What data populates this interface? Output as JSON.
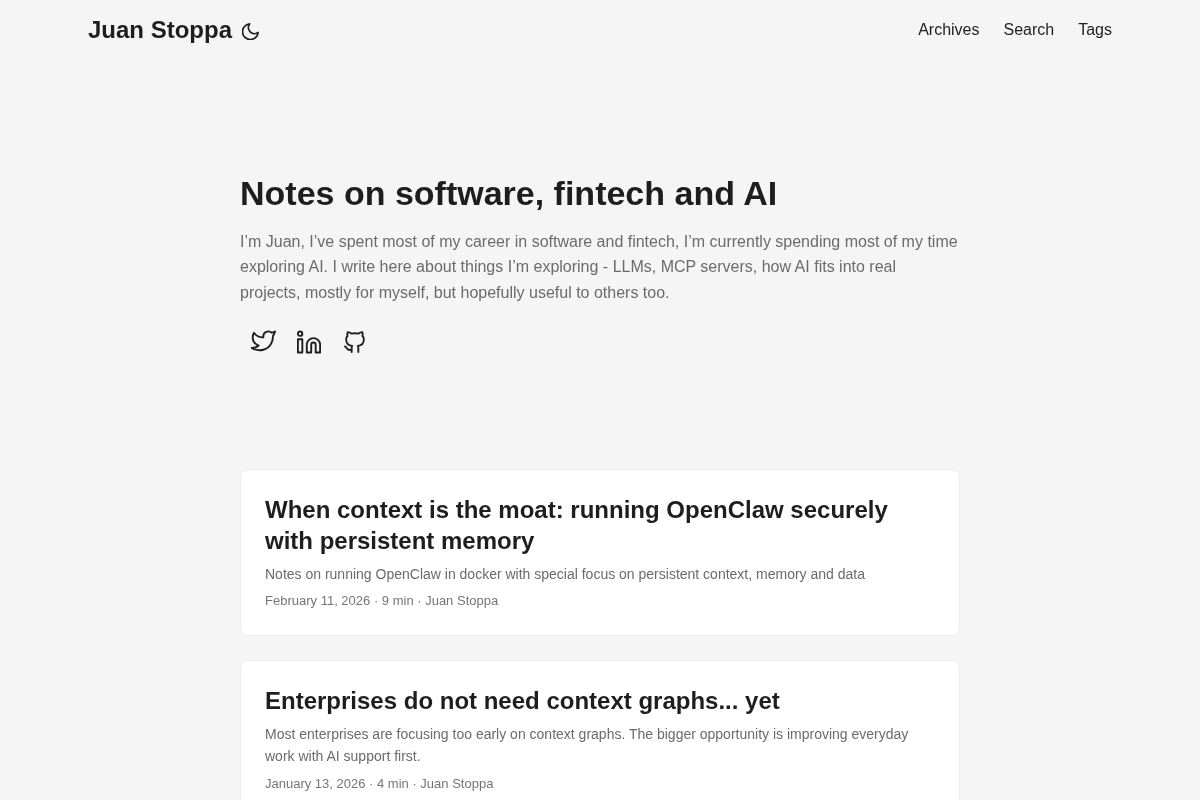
{
  "header": {
    "site_title": "Juan Stoppa",
    "nav": [
      {
        "label": "Archives"
      },
      {
        "label": "Search"
      },
      {
        "label": "Tags"
      }
    ]
  },
  "hero": {
    "title": "Notes on software, fintech and AI",
    "intro": "I’m Juan, I’ve spent most of my career in software and fintech, I’m currently spending most of my time exploring AI. I write here about things I’m exploring - LLMs, MCP servers, how AI fits into real projects, mostly for myself, but hopefully useful to others too."
  },
  "posts": [
    {
      "title": "When context is the moat: running OpenClaw securely with persistent memory",
      "summary": "Notes on running OpenClaw in docker with special focus on persistent context, memory and data",
      "meta": "February 11, 2026 · 9 min · Juan Stoppa"
    },
    {
      "title": "Enterprises do not need context graphs... yet",
      "summary": "Most enterprises are focusing too early on context graphs. The bigger opportunity is improving everyday work with AI support first.",
      "meta": "January 13, 2026 · 4 min · Juan Stoppa"
    }
  ]
}
